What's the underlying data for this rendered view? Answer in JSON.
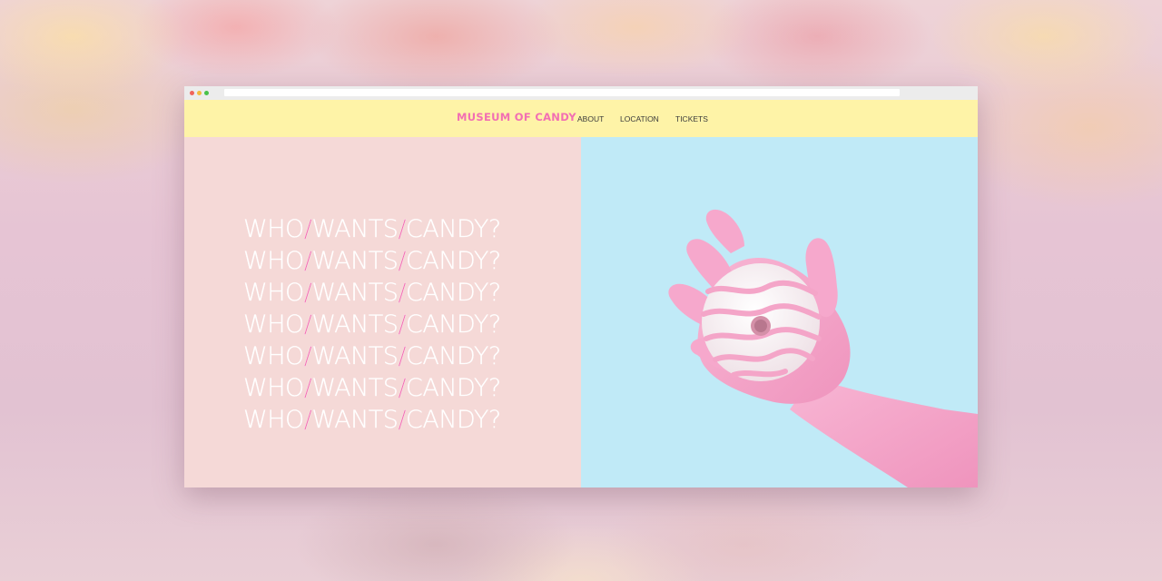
{
  "site": {
    "logo": "MUSEUM OF CANDY",
    "nav": [
      "ABOUT",
      "LOCATION",
      "TICKETS"
    ]
  },
  "hero": {
    "lines": [
      [
        "WHO",
        "/",
        "WANTS",
        "/",
        "CANDY?"
      ],
      [
        "WHO",
        "/",
        "WANTS",
        "/",
        "CANDY?"
      ],
      [
        "WHO",
        "/",
        "WANTS",
        "/",
        "CANDY?"
      ],
      [
        "WHO",
        "/",
        "WANTS",
        "/",
        "CANDY?"
      ],
      [
        "WHO",
        "/",
        "WANTS",
        "/",
        "CANDY?"
      ],
      [
        "WHO",
        "/",
        "WANTS",
        "/",
        "CANDY?"
      ],
      [
        "WHO",
        "/",
        "WANTS",
        "/",
        "CANDY?"
      ]
    ]
  },
  "image": {
    "subject": "pink-gloved-hand-holding-donut"
  },
  "colors": {
    "header_bg": "#fef3a7",
    "logo": "#f26fb3",
    "left_bg": "#f5d9d7",
    "right_bg": "#c0eaf7",
    "accent_slash": "#f26fb3",
    "glove": "#f6a8cc",
    "donut": "#fbf5f6"
  }
}
